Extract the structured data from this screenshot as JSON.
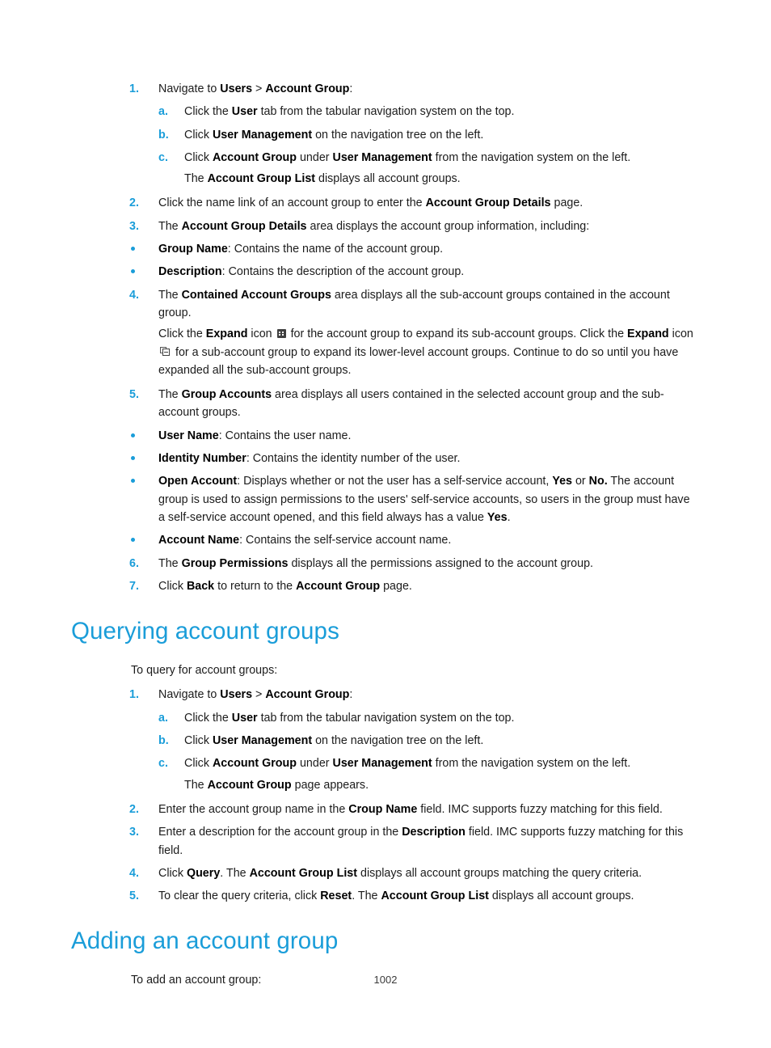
{
  "page": {
    "number": "1002",
    "accent_color": "#1a9dd9",
    "text_color": "#1c1c1c"
  },
  "details_procedure": {
    "steps": [
      {
        "marker": "1.",
        "text_before": "Navigate to ",
        "bold1": "Users",
        "mid": " > ",
        "bold2": "Account Group",
        "text_after": ":"
      },
      {
        "marker": "2.",
        "text_before": "Click the name link of an account group to enter the ",
        "bold1": "Account Group Details",
        "text_after": " page."
      },
      {
        "marker": "3.",
        "text_before": "The ",
        "bold1": "Account Group Details",
        "text_after": " area displays the account group information, including:"
      },
      {
        "marker": "4.",
        "text_before": "The ",
        "bold1": "Contained Account Groups",
        "text_after": " area displays all the sub-account groups contained in the account group."
      },
      {
        "marker": "5.",
        "text_before": "The ",
        "bold1": "Group Accounts",
        "text_after": " area displays all users contained in the selected account group and the sub-account groups."
      },
      {
        "marker": "6.",
        "text_before": "The ",
        "bold1": "Group Permissions",
        "text_after": " displays all the permissions assigned to the account group."
      },
      {
        "marker": "7.",
        "text_before": "Click ",
        "bold1": "Back",
        "mid": " to return to the ",
        "bold2": "Account Group",
        "text_after": " page."
      }
    ],
    "substeps": [
      {
        "marker": "a.",
        "text_before": "Click the ",
        "bold1": "User",
        "text_after": " tab from the tabular navigation system on the top."
      },
      {
        "marker": "b.",
        "text_before": "Click ",
        "bold1": "User Management",
        "text_after": " on the navigation tree on the left."
      },
      {
        "marker": "c.",
        "text_before": "Click ",
        "bold1": "Account Group",
        "mid": " under ",
        "bold2": "User Management",
        "text_after": " from the navigation system on the left."
      }
    ],
    "substep_note": {
      "text_before": "The ",
      "bold1": "Account Group List",
      "text_after": " displays all account groups."
    },
    "expand_note": {
      "seg1": "Click the ",
      "bold1": "Expand",
      "seg2": " icon ",
      "icon1": "expand-grid-icon",
      "seg3": " for the account group to expand its sub-account groups. Click the ",
      "bold2": "Expand",
      "seg4": " icon ",
      "icon2": "expand-collapse-box-icon",
      "seg5": " for a sub-account group to expand its lower-level account groups. Continue to do so until you have expanded all the sub-account groups."
    },
    "bullets": [
      {
        "bold1": "Group Name",
        "text_after": ": Contains the name of the account group."
      },
      {
        "bold1": "Description",
        "text_after": ": Contains the description of the account group."
      },
      {
        "bold1": "User Name",
        "text_after": ": Contains the user name."
      },
      {
        "bold1": "Identity Number",
        "text_after": ": Contains the identity number of the user."
      },
      {
        "bold1": "Account Name",
        "text_after": ": Contains the self-service account name."
      }
    ],
    "open_account_bullet": {
      "bold1": "Open Account",
      "seg1": ": Displays whether or not the user has a self-service account, ",
      "bold2": "Yes",
      "seg2": " or ",
      "bold3": "No.",
      "seg3": " The account group is used to assign permissions to the users' self-service accounts, so users in the group must have a self-service account opened, and this field always has a value ",
      "bold4": "Yes",
      "seg4": "."
    }
  },
  "querying_section": {
    "heading": "Querying account groups",
    "intro": "To query for account groups:",
    "steps": [
      {
        "marker": "1.",
        "text_before": "Navigate to ",
        "bold1": "Users",
        "mid": " > ",
        "bold2": "Account Group",
        "text_after": ":"
      },
      {
        "marker": "2.",
        "text_before": "Enter the account group name in the ",
        "bold1": "Croup Name",
        "text_after": " field. IMC supports fuzzy matching for this field."
      },
      {
        "marker": "3.",
        "text_before": "Enter a description for the account group in the ",
        "bold1": "Description",
        "text_after": " field. IMC supports fuzzy matching for this field."
      },
      {
        "marker": "4.",
        "text_before": "Click ",
        "bold1": "Query",
        "mid": ". The ",
        "bold2": "Account Group List",
        "text_after": " displays all account groups matching the query criteria."
      },
      {
        "marker": "5.",
        "text_before": "To clear the query criteria, click ",
        "bold1": "Reset",
        "mid": ". The ",
        "bold2": "Account Group List",
        "text_after": " displays all account groups."
      }
    ],
    "substeps": [
      {
        "marker": "a.",
        "text_before": "Click the ",
        "bold1": "User",
        "text_after": " tab from the tabular navigation system on the top."
      },
      {
        "marker": "b.",
        "text_before": "Click ",
        "bold1": "User Management",
        "text_after": " on the navigation tree on the left."
      },
      {
        "marker": "c.",
        "text_before": "Click ",
        "bold1": "Account Group",
        "mid": " under ",
        "bold2": "User Management",
        "text_after": " from the navigation system on the left."
      }
    ],
    "substep_note": {
      "text_before": "The ",
      "bold1": "Account Group",
      "text_after": " page appears."
    }
  },
  "adding_section": {
    "heading": "Adding an account group",
    "intro": "To add an account group:"
  }
}
